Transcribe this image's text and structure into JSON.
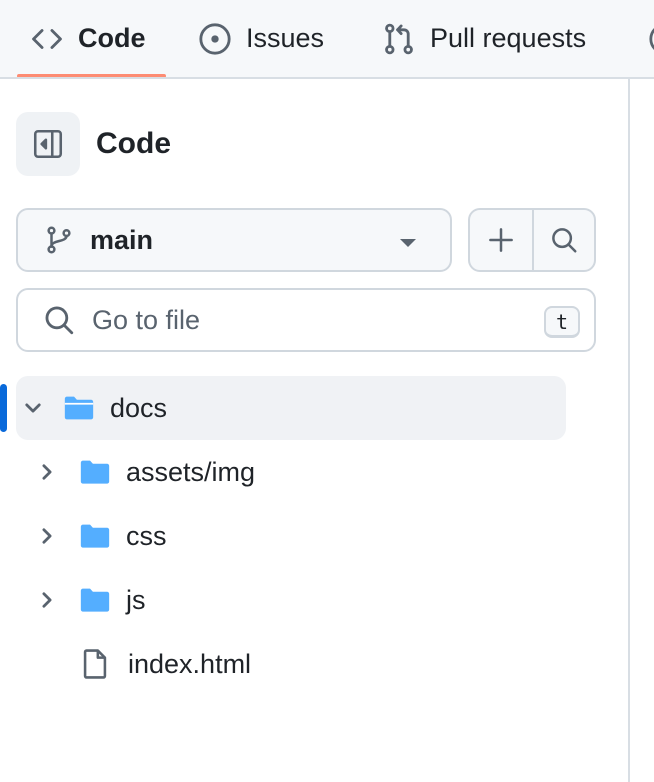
{
  "repo_nav": {
    "tabs": [
      {
        "label": "Code",
        "icon": "code-icon",
        "selected": true
      },
      {
        "label": "Issues",
        "icon": "issue-opened-icon",
        "selected": false
      },
      {
        "label": "Pull requests",
        "icon": "git-pull-request-icon",
        "selected": false
      }
    ]
  },
  "panel": {
    "title": "Code",
    "toggle_icon": "sidebar-collapse-icon"
  },
  "branch": {
    "name": "main",
    "icon": "git-branch-icon",
    "add_icon": "plus-icon",
    "search_icon": "search-icon"
  },
  "file_search": {
    "placeholder": "Go to file",
    "value": "",
    "shortcut": "t"
  },
  "tree": {
    "root": {
      "name": "docs",
      "expanded": true,
      "type": "folder-open"
    },
    "children": [
      {
        "name": "assets/img",
        "type": "folder",
        "expanded": false
      },
      {
        "name": "css",
        "type": "folder",
        "expanded": false
      },
      {
        "name": "js",
        "type": "folder",
        "expanded": false
      },
      {
        "name": "index.html",
        "type": "file"
      }
    ]
  },
  "colors": {
    "accent": "#0969da",
    "folder": "#54aeff",
    "tab_underline": "#fd8c73",
    "selected_row": "#f0f2f5"
  }
}
